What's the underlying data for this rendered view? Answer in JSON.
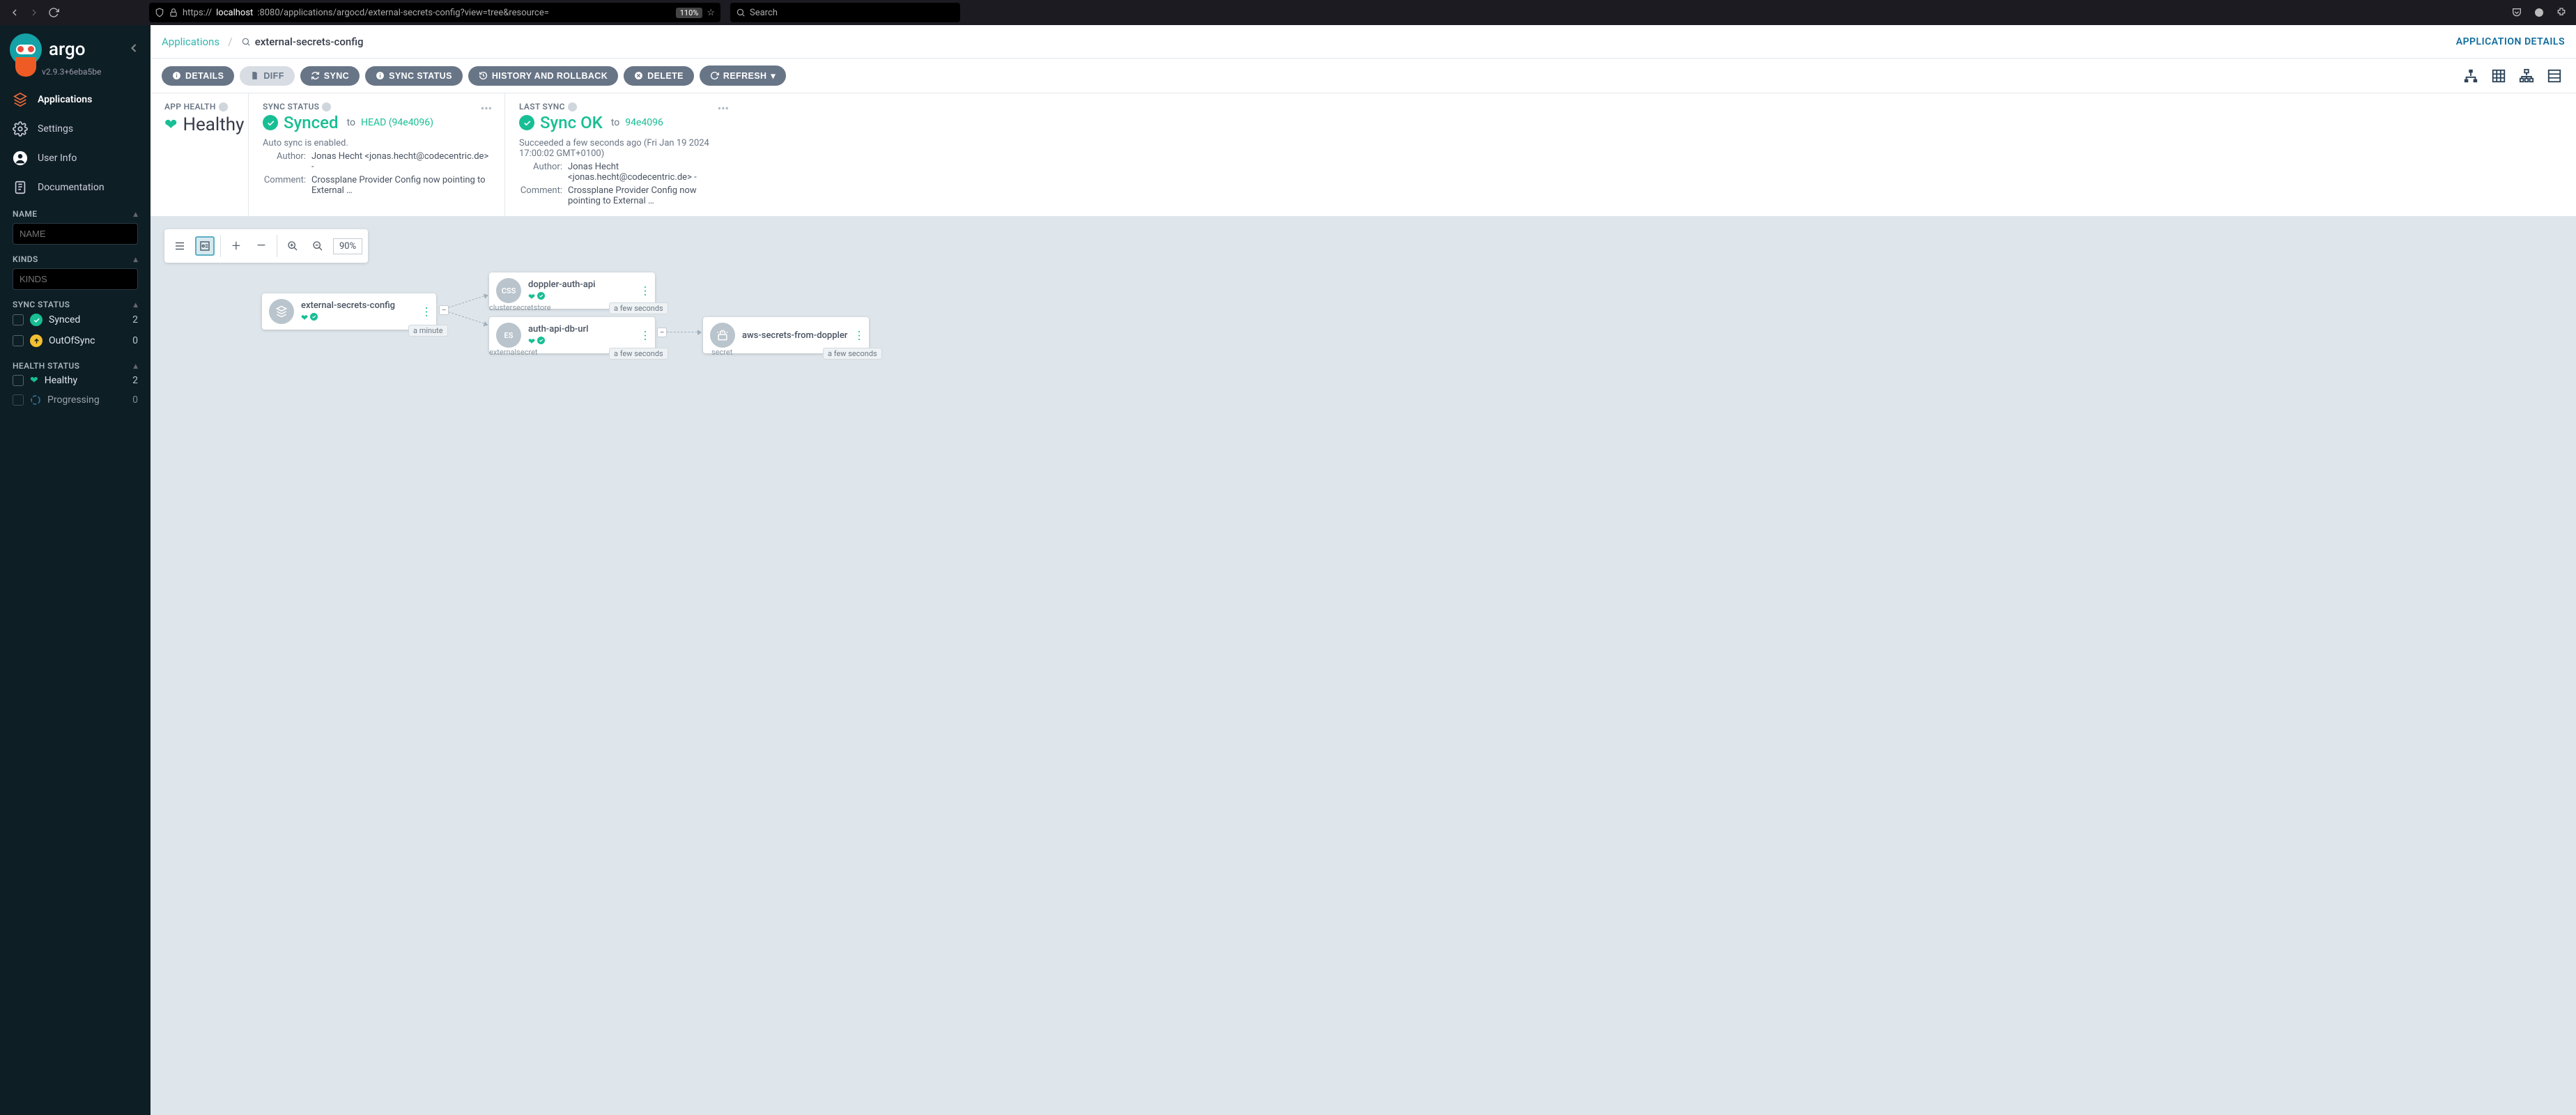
{
  "browser": {
    "url_prefix": "https://",
    "url_host": "localhost",
    "url_path": ":8080/applications/argocd/external-secrets-config?view=tree&resource=",
    "zoom": "110%",
    "search_placeholder": "Search"
  },
  "brand": {
    "name": "argo",
    "version": "v2.9.3+6eba5be"
  },
  "nav": {
    "applications": "Applications",
    "settings": "Settings",
    "userinfo": "User Info",
    "documentation": "Documentation"
  },
  "filters": {
    "name_label": "NAME",
    "name_placeholder": "NAME",
    "kinds_label": "KINDS",
    "kinds_placeholder": "KINDS",
    "sync_label": "SYNC STATUS",
    "synced_label": "Synced",
    "synced_count": "2",
    "oos_label": "OutOfSync",
    "oos_count": "0",
    "health_label": "HEALTH STATUS",
    "healthy_label": "Healthy",
    "healthy_count": "2",
    "progressing_label": "Progressing",
    "progressing_count": "0"
  },
  "crumbs": {
    "root": "Applications",
    "current": "external-secrets-config",
    "details": "APPLICATION DETAILS"
  },
  "toolbar": {
    "details": "DETAILS",
    "diff": "DIFF",
    "sync": "SYNC",
    "sync_status": "SYNC STATUS",
    "history": "HISTORY AND ROLLBACK",
    "delete": "DELETE",
    "refresh": "REFRESH"
  },
  "health_card": {
    "title": "APP HEALTH",
    "value": "Healthy"
  },
  "sync_card": {
    "title": "SYNC STATUS",
    "status": "Synced",
    "to": "to",
    "rev": "HEAD (94e4096)",
    "auto": "Auto sync is enabled.",
    "author_lbl": "Author:",
    "author": "Jonas Hecht <jonas.hecht@codecentric.de> -",
    "comment_lbl": "Comment:",
    "comment": "Crossplane Provider Config now pointing to External …"
  },
  "last_card": {
    "title": "LAST SYNC",
    "status": "Sync OK",
    "to": "to",
    "rev": "94e4096",
    "when": "Succeeded a few seconds ago (Fri Jan 19 2024 17:00:02 GMT+0100)",
    "author_lbl": "Author:",
    "author": "Jonas Hecht <jonas.hecht@codecentric.de> -",
    "comment_lbl": "Comment:",
    "comment": "Crossplane Provider Config now pointing to External …"
  },
  "canvas": {
    "zoom": "90%"
  },
  "nodes": {
    "root": {
      "title": "external-secrets-config",
      "age": "a minute"
    },
    "css": {
      "title": "doppler-auth-api",
      "kind": "clustersecretstore",
      "age": "a few seconds",
      "badge": "CSS"
    },
    "es": {
      "title": "auth-api-db-url",
      "kind": "externalsecret",
      "age": "a few seconds",
      "badge": "ES"
    },
    "sec": {
      "title": "aws-secrets-from-doppler",
      "kind": "secret",
      "age": "a few seconds"
    }
  }
}
